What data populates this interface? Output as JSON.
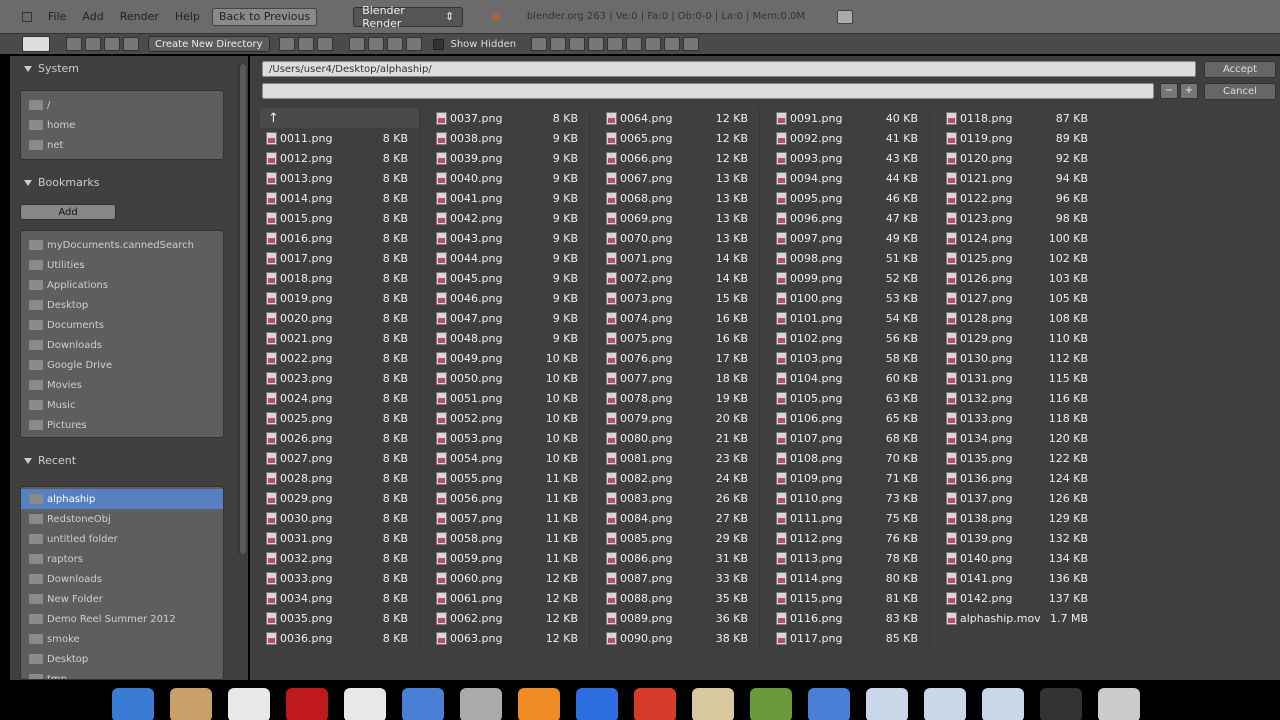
{
  "menubar": {
    "items": [
      "File",
      "Add",
      "Render",
      "Help"
    ],
    "back_label": "Back to Previous",
    "engine": "Blender Render",
    "info": "blender.org 263 | Ve:0 | Fa:0 | Ob:0-0 | La:0 | Mem:0.0M"
  },
  "toolbar": {
    "create_dir_label": "Create New Directory",
    "show_hidden_label": "Show Hidden"
  },
  "sidebar": {
    "system_title": "System",
    "system_items": [
      "/",
      "home",
      "net"
    ],
    "bookmarks_title": "Bookmarks",
    "add_label": "Add",
    "bookmark_items": [
      "myDocuments.cannedSearch",
      "Utilities",
      "Applications",
      "Desktop",
      "Documents",
      "Downloads",
      "Google Drive",
      "Movies",
      "Music",
      "Pictures"
    ],
    "recent_title": "Recent",
    "recent_items": [
      "alphaship",
      "RedstoneObj",
      "untitled folder",
      "raptors",
      "Downloads",
      "New Folder",
      "Demo Reel Summer 2012",
      "smoke",
      "Desktop",
      "tmp"
    ],
    "recent_selected": 0
  },
  "main": {
    "path": "/Users/user4/Desktop/alphaship/",
    "filename": "",
    "accept_label": "Accept",
    "cancel_label": "Cancel",
    "parent_symbol": "↑"
  },
  "files": [
    [
      [
        "0011.png",
        "8 KB"
      ],
      [
        "0012.png",
        "8 KB"
      ],
      [
        "0013.png",
        "8 KB"
      ],
      [
        "0014.png",
        "8 KB"
      ],
      [
        "0015.png",
        "8 KB"
      ],
      [
        "0016.png",
        "8 KB"
      ],
      [
        "0017.png",
        "8 KB"
      ],
      [
        "0018.png",
        "8 KB"
      ],
      [
        "0019.png",
        "8 KB"
      ],
      [
        "0020.png",
        "8 KB"
      ],
      [
        "0021.png",
        "8 KB"
      ],
      [
        "0022.png",
        "8 KB"
      ],
      [
        "0023.png",
        "8 KB"
      ],
      [
        "0024.png",
        "8 KB"
      ],
      [
        "0025.png",
        "8 KB"
      ],
      [
        "0026.png",
        "8 KB"
      ],
      [
        "0027.png",
        "8 KB"
      ],
      [
        "0028.png",
        "8 KB"
      ],
      [
        "0029.png",
        "8 KB"
      ],
      [
        "0030.png",
        "8 KB"
      ],
      [
        "0031.png",
        "8 KB"
      ],
      [
        "0032.png",
        "8 KB"
      ],
      [
        "0033.png",
        "8 KB"
      ],
      [
        "0034.png",
        "8 KB"
      ],
      [
        "0035.png",
        "8 KB"
      ],
      [
        "0036.png",
        "8 KB"
      ]
    ],
    [
      [
        "0037.png",
        "8 KB"
      ],
      [
        "0038.png",
        "9 KB"
      ],
      [
        "0039.png",
        "9 KB"
      ],
      [
        "0040.png",
        "9 KB"
      ],
      [
        "0041.png",
        "9 KB"
      ],
      [
        "0042.png",
        "9 KB"
      ],
      [
        "0043.png",
        "9 KB"
      ],
      [
        "0044.png",
        "9 KB"
      ],
      [
        "0045.png",
        "9 KB"
      ],
      [
        "0046.png",
        "9 KB"
      ],
      [
        "0047.png",
        "9 KB"
      ],
      [
        "0048.png",
        "9 KB"
      ],
      [
        "0049.png",
        "10 KB"
      ],
      [
        "0050.png",
        "10 KB"
      ],
      [
        "0051.png",
        "10 KB"
      ],
      [
        "0052.png",
        "10 KB"
      ],
      [
        "0053.png",
        "10 KB"
      ],
      [
        "0054.png",
        "10 KB"
      ],
      [
        "0055.png",
        "11 KB"
      ],
      [
        "0056.png",
        "11 KB"
      ],
      [
        "0057.png",
        "11 KB"
      ],
      [
        "0058.png",
        "11 KB"
      ],
      [
        "0059.png",
        "11 KB"
      ],
      [
        "0060.png",
        "12 KB"
      ],
      [
        "0061.png",
        "12 KB"
      ],
      [
        "0062.png",
        "12 KB"
      ],
      [
        "0063.png",
        "12 KB"
      ]
    ],
    [
      [
        "0064.png",
        "12 KB"
      ],
      [
        "0065.png",
        "12 KB"
      ],
      [
        "0066.png",
        "12 KB"
      ],
      [
        "0067.png",
        "13 KB"
      ],
      [
        "0068.png",
        "13 KB"
      ],
      [
        "0069.png",
        "13 KB"
      ],
      [
        "0070.png",
        "13 KB"
      ],
      [
        "0071.png",
        "14 KB"
      ],
      [
        "0072.png",
        "14 KB"
      ],
      [
        "0073.png",
        "15 KB"
      ],
      [
        "0074.png",
        "16 KB"
      ],
      [
        "0075.png",
        "16 KB"
      ],
      [
        "0076.png",
        "17 KB"
      ],
      [
        "0077.png",
        "18 KB"
      ],
      [
        "0078.png",
        "19 KB"
      ],
      [
        "0079.png",
        "20 KB"
      ],
      [
        "0080.png",
        "21 KB"
      ],
      [
        "0081.png",
        "23 KB"
      ],
      [
        "0082.png",
        "24 KB"
      ],
      [
        "0083.png",
        "26 KB"
      ],
      [
        "0084.png",
        "27 KB"
      ],
      [
        "0085.png",
        "29 KB"
      ],
      [
        "0086.png",
        "31 KB"
      ],
      [
        "0087.png",
        "33 KB"
      ],
      [
        "0088.png",
        "35 KB"
      ],
      [
        "0089.png",
        "36 KB"
      ],
      [
        "0090.png",
        "38 KB"
      ]
    ],
    [
      [
        "0091.png",
        "40 KB"
      ],
      [
        "0092.png",
        "41 KB"
      ],
      [
        "0093.png",
        "43 KB"
      ],
      [
        "0094.png",
        "44 KB"
      ],
      [
        "0095.png",
        "46 KB"
      ],
      [
        "0096.png",
        "47 KB"
      ],
      [
        "0097.png",
        "49 KB"
      ],
      [
        "0098.png",
        "51 KB"
      ],
      [
        "0099.png",
        "52 KB"
      ],
      [
        "0100.png",
        "53 KB"
      ],
      [
        "0101.png",
        "54 KB"
      ],
      [
        "0102.png",
        "56 KB"
      ],
      [
        "0103.png",
        "58 KB"
      ],
      [
        "0104.png",
        "60 KB"
      ],
      [
        "0105.png",
        "63 KB"
      ],
      [
        "0106.png",
        "65 KB"
      ],
      [
        "0107.png",
        "68 KB"
      ],
      [
        "0108.png",
        "70 KB"
      ],
      [
        "0109.png",
        "71 KB"
      ],
      [
        "0110.png",
        "73 KB"
      ],
      [
        "0111.png",
        "75 KB"
      ],
      [
        "0112.png",
        "76 KB"
      ],
      [
        "0113.png",
        "78 KB"
      ],
      [
        "0114.png",
        "80 KB"
      ],
      [
        "0115.png",
        "81 KB"
      ],
      [
        "0116.png",
        "83 KB"
      ],
      [
        "0117.png",
        "85 KB"
      ]
    ],
    [
      [
        "0118.png",
        "87 KB"
      ],
      [
        "0119.png",
        "89 KB"
      ],
      [
        "0120.png",
        "92 KB"
      ],
      [
        "0121.png",
        "94 KB"
      ],
      [
        "0122.png",
        "96 KB"
      ],
      [
        "0123.png",
        "98 KB"
      ],
      [
        "0124.png",
        "100 KB"
      ],
      [
        "0125.png",
        "102 KB"
      ],
      [
        "0126.png",
        "103 KB"
      ],
      [
        "0127.png",
        "105 KB"
      ],
      [
        "0128.png",
        "108 KB"
      ],
      [
        "0129.png",
        "110 KB"
      ],
      [
        "0130.png",
        "112 KB"
      ],
      [
        "0131.png",
        "115 KB"
      ],
      [
        "0132.png",
        "116 KB"
      ],
      [
        "0133.png",
        "118 KB"
      ],
      [
        "0134.png",
        "120 KB"
      ],
      [
        "0135.png",
        "122 KB"
      ],
      [
        "0136.png",
        "124 KB"
      ],
      [
        "0137.png",
        "126 KB"
      ],
      [
        "0138.png",
        "129 KB"
      ],
      [
        "0139.png",
        "132 KB"
      ],
      [
        "0140.png",
        "134 KB"
      ],
      [
        "0141.png",
        "136 KB"
      ],
      [
        "0142.png",
        "137 KB"
      ],
      [
        "alphaship.mov",
        "1.7 MB"
      ]
    ]
  ],
  "dock": {
    "icon_names": [
      "finder-icon",
      "utility-icon",
      "star-icon",
      "photobooth-icon",
      "safari-icon",
      "mail-icon",
      "pen-icon",
      "blender-icon",
      "itunes-icon",
      "chrome-icon",
      "gimp-icon",
      "photo-icon",
      "network-icon",
      "folder-icon",
      "folder-icon",
      "folder-icon",
      "terminal-icon",
      "trash-icon"
    ],
    "icon_colors": [
      "#3a7bd5",
      "#c9a06a",
      "#e8e8e8",
      "#c0191c",
      "#e8e8e8",
      "#4a7fd6",
      "#aaa",
      "#f08a24",
      "#2d6fe0",
      "#d93b2b",
      "#d8c8a0",
      "#6a9a3a",
      "#4a7fd6",
      "#c9d7e8",
      "#c9d7e8",
      "#c9d7e8",
      "#333",
      "#ccc"
    ]
  },
  "colors": {
    "selection": "#5680c2",
    "panel_bg": "#404040",
    "main_bg": "#3f3f3f"
  }
}
